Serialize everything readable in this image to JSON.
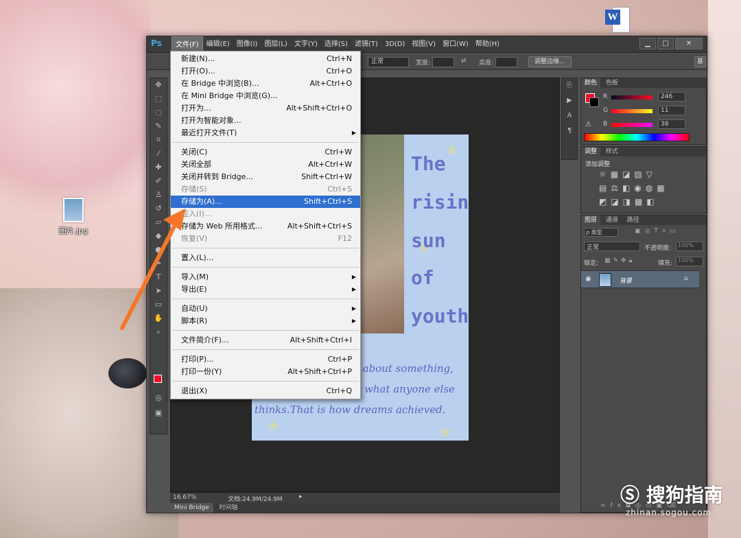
{
  "desktop": {
    "jpg_icon_label": "图片.jpg",
    "word_icon_glyph": "W"
  },
  "ps": {
    "logo": "Ps",
    "menus": [
      "文件(F)",
      "编辑(E)",
      "图像(I)",
      "图层(L)",
      "文字(Y)",
      "选择(S)",
      "滤镜(T)",
      "3D(D)",
      "视图(V)",
      "窗口(W)",
      "帮助(H)"
    ],
    "window_buttons": [
      "▁",
      "□",
      "✕"
    ],
    "options": {
      "style_value": "正常",
      "width_label": "宽度:",
      "height_label": "高度:",
      "refine_edge": "调整边缘...",
      "workspace": "基"
    },
    "status": {
      "zoom": "16.67%",
      "doc_size": "文档:24.9M/24.9M"
    },
    "bottom_tabs": [
      "Mini Bridge",
      "时间轴"
    ]
  },
  "document": {
    "title_words": [
      "The",
      "rising",
      "sun",
      "of",
      "youth"
    ],
    "body_lines": [
      "e about something,",
      "what anyone else",
      "thinks.That is how dreams achieved."
    ]
  },
  "file_menu": {
    "items": [
      {
        "label": "新建(N)...",
        "shortcut": "Ctrl+N"
      },
      {
        "label": "打开(O)...",
        "shortcut": "Ctrl+O"
      },
      {
        "label": "在 Bridge 中浏览(B)...",
        "shortcut": "Alt+Ctrl+O"
      },
      {
        "label": "在 Mini Bridge 中浏览(G)...",
        "shortcut": ""
      },
      {
        "label": "打开为...",
        "shortcut": "Alt+Shift+Ctrl+O"
      },
      {
        "label": "打开为智能对象...",
        "shortcut": ""
      },
      {
        "label": "最近打开文件(T)",
        "shortcut": ""
      },
      {
        "label": "关闭(C)",
        "shortcut": "Ctrl+W"
      },
      {
        "label": "关闭全部",
        "shortcut": "Alt+Ctrl+W"
      },
      {
        "label": "关闭并转到 Bridge...",
        "shortcut": "Shift+Ctrl+W"
      },
      {
        "label": "存储(S)",
        "shortcut": "Ctrl+S"
      },
      {
        "label": "存储为(A)...",
        "shortcut": "Shift+Ctrl+S"
      },
      {
        "label": "签入(I)...",
        "shortcut": ""
      },
      {
        "label": "存储为 Web 所用格式...",
        "shortcut": "Alt+Shift+Ctrl+S"
      },
      {
        "label": "恢复(V)",
        "shortcut": "F12"
      },
      {
        "label": "置入(L)...",
        "shortcut": ""
      },
      {
        "label": "导入(M)",
        "shortcut": ""
      },
      {
        "label": "导出(E)",
        "shortcut": ""
      },
      {
        "label": "自动(U)",
        "shortcut": ""
      },
      {
        "label": "脚本(R)",
        "shortcut": ""
      },
      {
        "label": "文件简介(F)...",
        "shortcut": "Alt+Shift+Ctrl+I"
      },
      {
        "label": "打印(P)...",
        "shortcut": "Ctrl+P"
      },
      {
        "label": "打印一份(Y)",
        "shortcut": "Alt+Shift+Ctrl+P"
      },
      {
        "label": "退出(X)",
        "shortcut": "Ctrl+Q"
      }
    ]
  },
  "color_panel": {
    "tabs": [
      "颜色",
      "色板"
    ],
    "r_label": "R",
    "g_label": "G",
    "b_label": "B",
    "r": "246",
    "g": "11",
    "b": "38",
    "fg_color": "#f60b26"
  },
  "adjust_panel": {
    "tabs": [
      "调整",
      "样式"
    ],
    "add_label": "添加调整"
  },
  "layers_panel": {
    "tabs": [
      "图层",
      "通道",
      "路径"
    ],
    "kind": "ρ 类型",
    "blend": "正常",
    "opacity_label": "不透明度:",
    "opacity": "100%",
    "lock_label": "锁定:",
    "fill_label": "填充:",
    "fill": "100%",
    "layer_name": "背景"
  },
  "watermark": {
    "brand": "搜狗指南",
    "url": "zhinan.sogou.com"
  }
}
